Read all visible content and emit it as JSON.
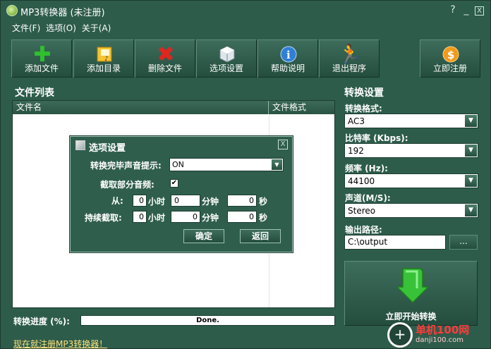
{
  "window": {
    "title": "MP3转换器 (未注册)",
    "controls": [
      "?",
      "_",
      "X"
    ]
  },
  "menu": [
    "文件(F)",
    "选项(O)",
    "关于(A)"
  ],
  "toolbar": [
    {
      "label": "添加文件",
      "icon": "add-file-icon"
    },
    {
      "label": "添加目录",
      "icon": "add-folder-icon"
    },
    {
      "label": "删除文件",
      "icon": "delete-icon"
    },
    {
      "label": "选项设置",
      "icon": "options-icon"
    },
    {
      "label": "帮助说明",
      "icon": "info-icon"
    },
    {
      "label": "退出程序",
      "icon": "exit-icon"
    },
    {
      "label": "立即注册",
      "icon": "register-icon"
    }
  ],
  "file_list": {
    "title": "文件列表",
    "columns": [
      "文件名",
      "文件格式"
    ]
  },
  "progress": {
    "label": "转换进度 (%):",
    "status": "Done."
  },
  "footer_link": "现在就注册MP3转换器！",
  "settings": {
    "title": "转换设置",
    "format_label": "转换格式:",
    "format_value": "AC3",
    "bitrate_label": "比特率 (Kbps):",
    "bitrate_value": "192",
    "frequency_label": "频率 (Hz):",
    "frequency_value": "44100",
    "channel_label": "声道(M/S):",
    "channel_value": "Stereo",
    "output_label": "输出路径:",
    "output_value": "C:\\output",
    "browse_label": "...",
    "start_label": "立即开始转换"
  },
  "watermark": {
    "text": "单机100网",
    "sub": "danji100.com"
  },
  "dialog": {
    "title": "选项设置",
    "close": "X",
    "notify_label": "转换完毕声音提示:",
    "notify_value": "ON",
    "partial_label": "截取部分音频:",
    "partial_checked": "✔",
    "from_label": "从:",
    "duration_label": "持续截取:",
    "hour_unit": "小时",
    "minute_unit": "分钟",
    "second_unit": "秒",
    "from_hours": "0",
    "from_minutes": "0",
    "from_seconds": "0",
    "dur_hours": "0",
    "dur_minutes": "0",
    "dur_seconds": "0",
    "ok_label": "确定",
    "back_label": "返回"
  },
  "colors": {
    "background": "#2d5c4b",
    "accent_link": "#ffe27a",
    "add_green": "#2fbf2f",
    "delete_red": "#e0261e"
  }
}
